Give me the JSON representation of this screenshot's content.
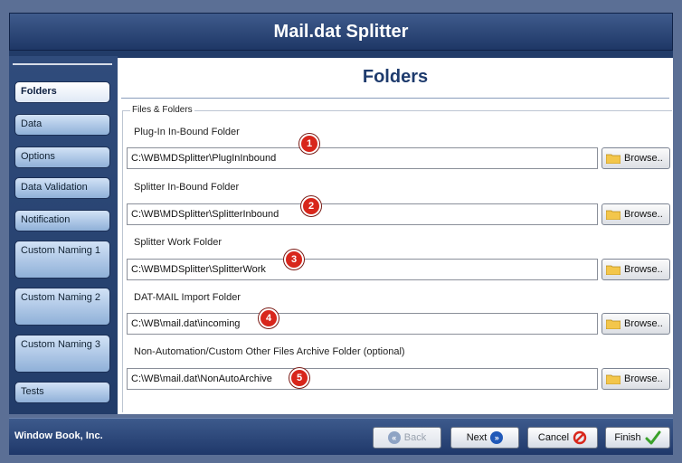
{
  "window": {
    "title": "Mail.dat Splitter"
  },
  "sidebar": {
    "items": [
      {
        "label": "Folders",
        "active": true
      },
      {
        "label": "Data"
      },
      {
        "label": "Options"
      },
      {
        "label": "Data Validation"
      },
      {
        "label": "Notification"
      },
      {
        "label": "Custom Naming 1"
      },
      {
        "label": "Custom Naming 2"
      },
      {
        "label": "Custom Naming 3"
      },
      {
        "label": "Tests"
      }
    ]
  },
  "main": {
    "title": "Folders",
    "group_label": "Files & Folders",
    "fields": [
      {
        "label": "Plug-In In-Bound Folder",
        "value": "C:\\WB\\MDSplitter\\PlugInInbound",
        "badge": "1"
      },
      {
        "label": "Splitter In-Bound Folder",
        "value": "C:\\WB\\MDSplitter\\SplitterInbound",
        "badge": "2"
      },
      {
        "label": "Splitter Work Folder",
        "value": "C:\\WB\\MDSplitter\\SplitterWork",
        "badge": "3"
      },
      {
        "label": "DAT-MAIL Import Folder",
        "value": "C:\\WB\\mail.dat\\incoming",
        "badge": "4"
      },
      {
        "label": "Non-Automation/Custom Other Files Archive Folder (optional)",
        "value": "C:\\WB\\mail.dat\\NonAutoArchive",
        "badge": "5"
      }
    ],
    "browse_label": "Browse.."
  },
  "footer": {
    "company": "Window Book, Inc.",
    "back_label": "Back",
    "next_label": "Next",
    "cancel_label": "Cancel",
    "finish_label": "Finish"
  },
  "colors": {
    "title_bar": "#2a4578",
    "badge_red": "#d8261b",
    "finish_check": "#3aa12a"
  }
}
